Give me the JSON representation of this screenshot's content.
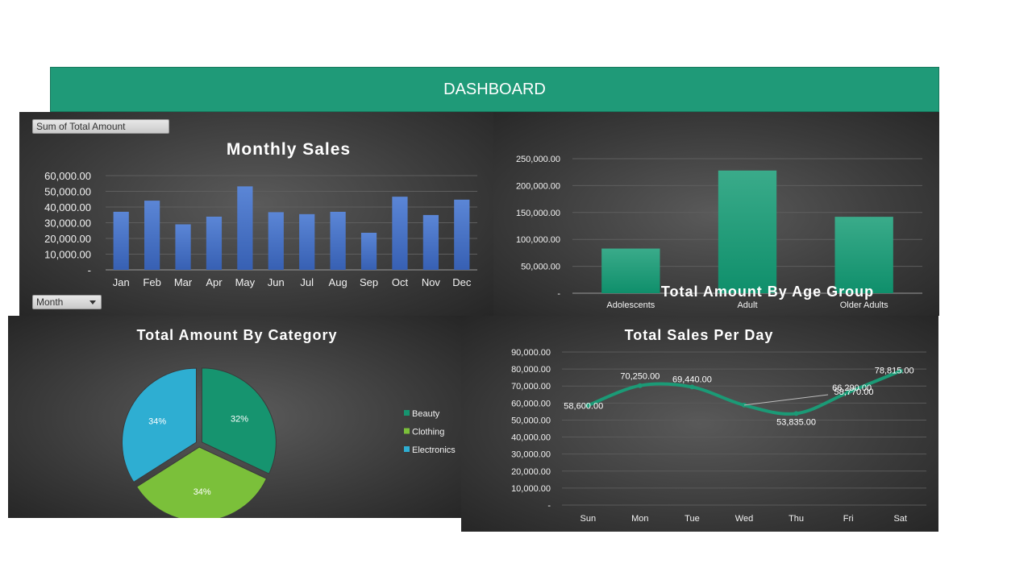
{
  "header": {
    "title": "DASHBOARD"
  },
  "pivot": {
    "value_button": "Sum of Total Amount",
    "axis_button": "Month"
  },
  "colors": {
    "header": "#1f9a78",
    "bar_blue": "#4472c4",
    "bar_green": "#149a78",
    "beauty": "#16946f",
    "clothing": "#7bc03a",
    "electronics": "#2eaed2",
    "line": "#1b9a76"
  },
  "chart_data": [
    {
      "id": "monthly-sales",
      "type": "bar",
      "title": "Monthly Sales",
      "categories": [
        "Jan",
        "Feb",
        "Mar",
        "Apr",
        "May",
        "Jun",
        "Jul",
        "Aug",
        "Sep",
        "Oct",
        "Nov",
        "Dec"
      ],
      "values": [
        36980,
        44060,
        28990,
        33870,
        53150,
        36715,
        35465,
        36960,
        23620,
        46580,
        34920,
        44690
      ],
      "ylim": [
        0,
        60000
      ],
      "yticks": [
        "-",
        "10,000.00",
        "20,000.00",
        "30,000.00",
        "40,000.00",
        "50,000.00",
        "60,000.00"
      ],
      "grid": true
    },
    {
      "id": "age-group",
      "type": "bar",
      "title": "Total Amount By Age Group",
      "categories": [
        "Adolescents",
        "Adult",
        "Older Adults"
      ],
      "values": [
        83000,
        228000,
        142000
      ],
      "ylim": [
        0,
        250000
      ],
      "yticks": [
        "-",
        "50,000.00",
        "100,000.00",
        "150,000.00",
        "200,000.00",
        "250,000.00"
      ],
      "grid": true
    },
    {
      "id": "category",
      "type": "pie",
      "title": "Total Amount By Category",
      "slices": [
        {
          "name": "Beauty",
          "value": 32,
          "label": "32%"
        },
        {
          "name": "Clothing",
          "value": 34,
          "label": "34%"
        },
        {
          "name": "Electronics",
          "value": 34,
          "label": "34%"
        }
      ],
      "legend": "right"
    },
    {
      "id": "sales-per-day",
      "type": "line",
      "title": "Total Sales Per Day",
      "categories": [
        "Sun",
        "Mon",
        "Tue",
        "Wed",
        "Thu",
        "Fri",
        "Sat"
      ],
      "values": [
        58600,
        70250,
        69440,
        58770,
        53835,
        66290,
        78815
      ],
      "data_labels": [
        "58,600.00",
        "70,250.00",
        "69,440.00",
        "58,770.00",
        "53,835.00",
        "66,290.00",
        "78,815.00"
      ],
      "ylim": [
        0,
        90000
      ],
      "yticks": [
        "-",
        "10,000.00",
        "20,000.00",
        "30,000.00",
        "40,000.00",
        "50,000.00",
        "60,000.00",
        "70,000.00",
        "80,000.00",
        "90,000.00"
      ],
      "grid": true
    }
  ]
}
